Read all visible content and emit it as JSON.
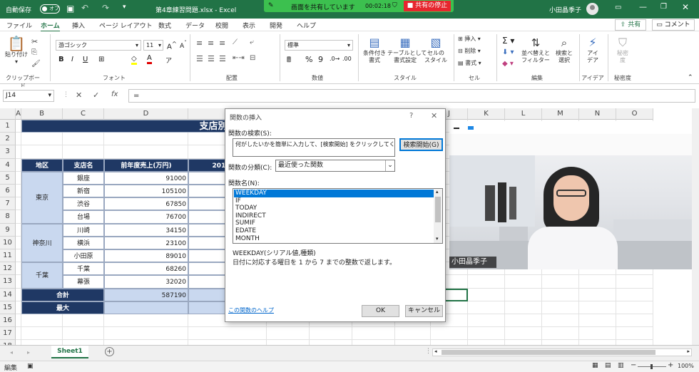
{
  "titlebar": {
    "autosave_label": "自動保存",
    "autosave_state": "オフ",
    "filename": "第4章練習問題.xlsx  -  Excel",
    "user_name": "小田晶季子",
    "share_banner": {
      "text": "画面を共有しています",
      "time": "00:02:18",
      "stop_label": "共有の停止"
    }
  },
  "ribbon_tabs": [
    "ファイル",
    "ホーム",
    "挿入",
    "ページ レイアウト",
    "数式",
    "データ",
    "校閲",
    "表示",
    "開発",
    "ヘルプ"
  ],
  "active_tab": "ホーム",
  "share_button": "共有",
  "comment_button": "コメント",
  "ribbon": {
    "clipboard": {
      "label": "クリップボード",
      "paste": "貼り付け"
    },
    "font": {
      "label": "フォント",
      "name": "游ゴシック",
      "size": "11"
    },
    "alignment": {
      "label": "配置"
    },
    "number": {
      "label": "数値",
      "format": "標準"
    },
    "styles": {
      "label": "スタイル",
      "conditional": "条件付き\n書式",
      "table": "テーブルとして\n書式設定",
      "cell_style": "セルの\nスタイル"
    },
    "cells": {
      "label": "セル",
      "insert": "挿入",
      "delete": "削除",
      "format": "書式"
    },
    "editing": {
      "label": "編集",
      "sort": "並べ替えと\nフィルター",
      "find": "検索と\n選択"
    },
    "ideas": {
      "label": "アイデア",
      "button": "アイ\nデア"
    },
    "sensitivity": {
      "label": "秘密度",
      "button": "秘密\n度"
    }
  },
  "formula_bar": {
    "name_box": "J14",
    "formula": "="
  },
  "columns": [
    "A",
    "B",
    "C",
    "D",
    "E",
    "F",
    "G",
    "H",
    "I",
    "J",
    "K",
    "L",
    "M",
    "N",
    "O"
  ],
  "rows": [
    "1",
    "2",
    "3",
    "4",
    "5",
    "6",
    "7",
    "8",
    "9",
    "10",
    "11",
    "12",
    "13",
    "14",
    "15",
    "16",
    "17",
    "18"
  ],
  "sheet": {
    "title": "支店別売上",
    "headers": [
      "地区",
      "支店名",
      "前年度売上(万円)",
      "2014年度"
    ],
    "regions": [
      "東京",
      "神奈川",
      "千葉"
    ],
    "branches": [
      "銀座",
      "新宿",
      "渋谷",
      "台場",
      "川崎",
      "横浜",
      "小田原",
      "千葉",
      "幕張"
    ],
    "sales": [
      "91000",
      "105100",
      "67850",
      "76700",
      "34150",
      "23100",
      "89010",
      "68260",
      "32020"
    ],
    "total_label": "合計",
    "total_value": "587190",
    "max_label": "最大",
    "j14": "="
  },
  "dialog": {
    "title": "関数の挿入",
    "help_char": "?",
    "search_label": "関数の検索(S):",
    "search_text": "何がしたいかを簡単に入力して、[検索開始] をクリックしてください。",
    "search_button": "検索開始(G)",
    "category_label": "関数の分類(C):",
    "category_value": "最近使った関数",
    "list_label": "関数名(N):",
    "functions": [
      "WEEKDAY",
      "IF",
      "TODAY",
      "INDIRECT",
      "SUMIF",
      "EDATE",
      "MONTH"
    ],
    "selected": "WEEKDAY",
    "syntax": "WEEKDAY(シリアル値,種類)",
    "description": "日付に対応する曜日を 1 から 7 までの整数で返します。",
    "help_link": "この関数のヘルプ",
    "ok": "OK",
    "cancel": "キャンセル"
  },
  "video": {
    "name": "小田晶季子"
  },
  "sheet_tab": "Sheet1",
  "status": {
    "mode": "編集",
    "zoom": "100%"
  },
  "colors": {
    "excel_green": "#217346",
    "header_navy": "#1f3864",
    "light_blue": "#c9d8ef"
  }
}
